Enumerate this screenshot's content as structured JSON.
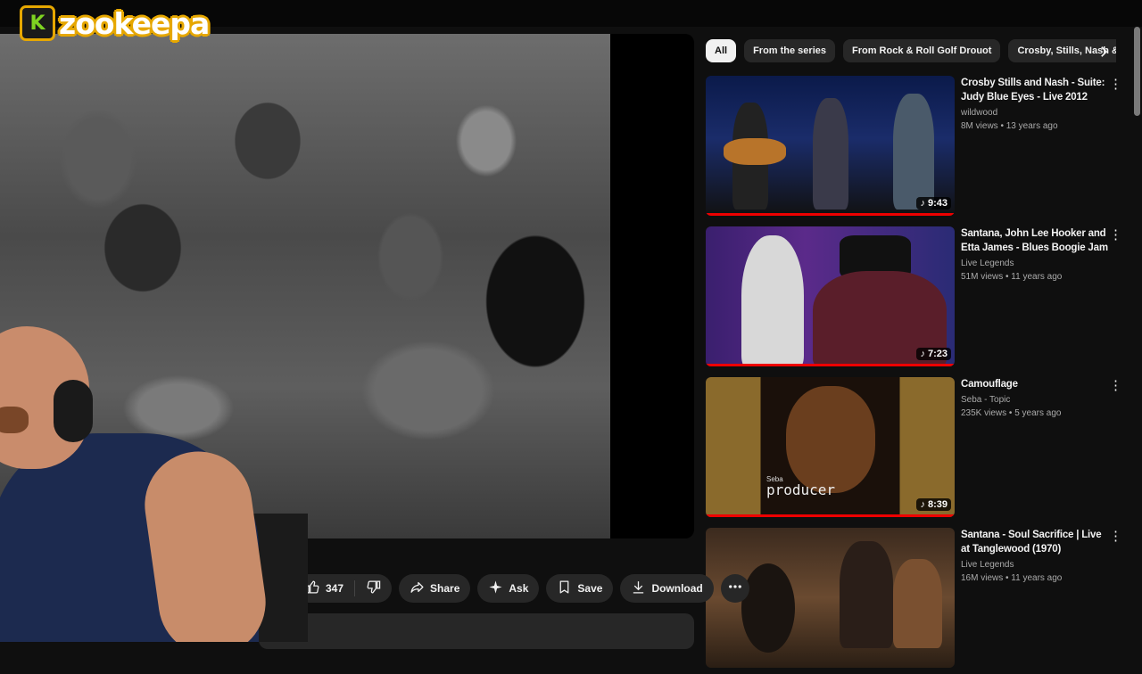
{
  "overlay": {
    "logo_letter": "K",
    "logo_text": "zookeepa"
  },
  "actions": {
    "like_count": "347",
    "share_label": "Share",
    "ask_label": "Ask",
    "save_label": "Save",
    "download_label": "Download"
  },
  "chips": [
    "All",
    "From the series",
    "From Rock & Roll Golf Drouot",
    "Crosby, Stills, Nash & Young"
  ],
  "recommendations": [
    {
      "title": "Crosby Stills and Nash - Suite: Judy Blue Eyes - Live 2012",
      "channel": "wildwood",
      "stats": "8M views • 13 years ago",
      "duration": "9:43"
    },
    {
      "title": "Santana, John Lee Hooker and Etta James - Blues Boogie Jam",
      "channel": "Live Legends",
      "stats": "51M views • 11 years ago",
      "duration": "7:23"
    },
    {
      "title": "Camouflage",
      "channel": "Seba - Topic",
      "stats": "235K views • 5 years ago",
      "duration": "8:39",
      "thumb_text": "Seba",
      "thumb_word": "producer"
    },
    {
      "title": "Santana - Soul Sacrifice | Live at Tanglewood (1970)",
      "channel": "Live Legends",
      "stats": "16M views • 11 years ago",
      "duration": ""
    }
  ],
  "icons": {
    "like": "thumbs-up-icon",
    "dislike": "thumbs-down-icon",
    "share": "share-arrow-icon",
    "ask": "sparkle-icon",
    "save": "bookmark-icon",
    "download": "download-icon",
    "more": "more-horizontal-icon",
    "music": "music-note-icon"
  }
}
